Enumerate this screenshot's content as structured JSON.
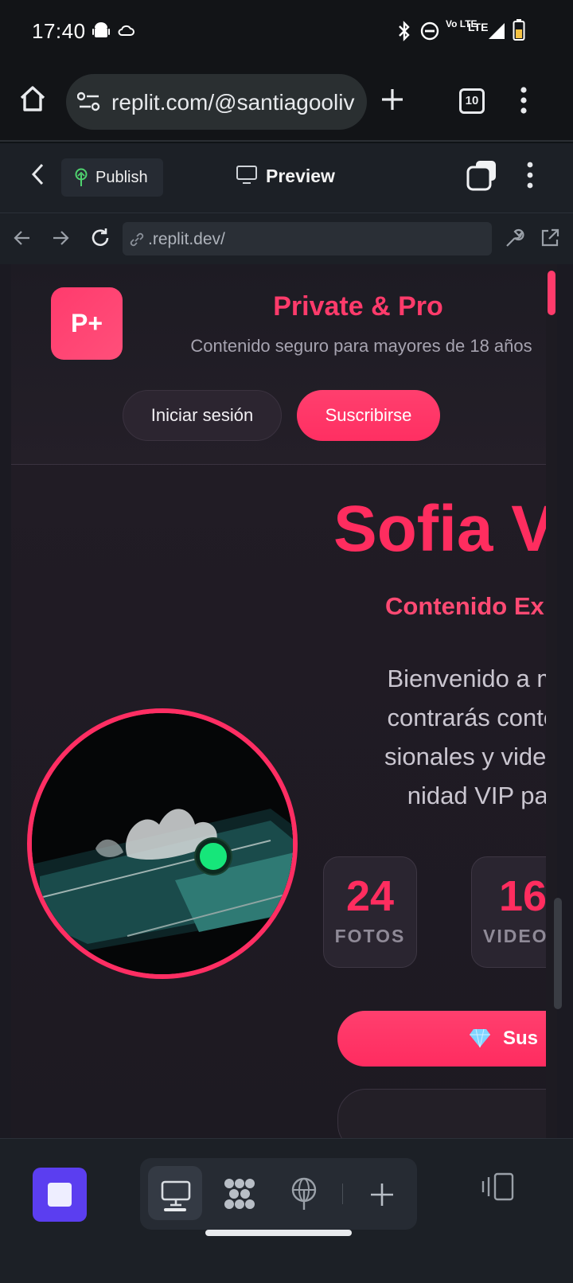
{
  "status_bar": {
    "time": "17:40",
    "network_label_top": "Vo LTE",
    "network_label_main": "LTE"
  },
  "browser": {
    "url": "replit.com/@santiagooliv",
    "tab_count": "10"
  },
  "replit": {
    "publish_label": "Publish",
    "preview_label": "Preview",
    "webview_url": ".replit.dev/"
  },
  "site": {
    "logo_text": "P+",
    "brand_name": "Private & Pro",
    "brand_tagline": "Contenido seguro para mayores de 18 años",
    "login_label": "Iniciar sesión",
    "subscribe_label": "Suscribirse",
    "hero": {
      "name": "Sofia V",
      "tagline": "Contenido Ex",
      "description_lines": [
        "Bienvenido a mi m",
        "contrarás contenid",
        "sionales y videos ú",
        "nidad VIP para"
      ]
    },
    "stats": [
      {
        "value": "24",
        "label": "FOTOS"
      },
      {
        "value": "16",
        "label": "VIDEO"
      }
    ],
    "cta_label": "Sus",
    "cta_icon": "gem-icon"
  },
  "colors": {
    "accent": "#ff2d5f",
    "online": "#16e67a",
    "replit_purple": "#5b3ef0"
  }
}
